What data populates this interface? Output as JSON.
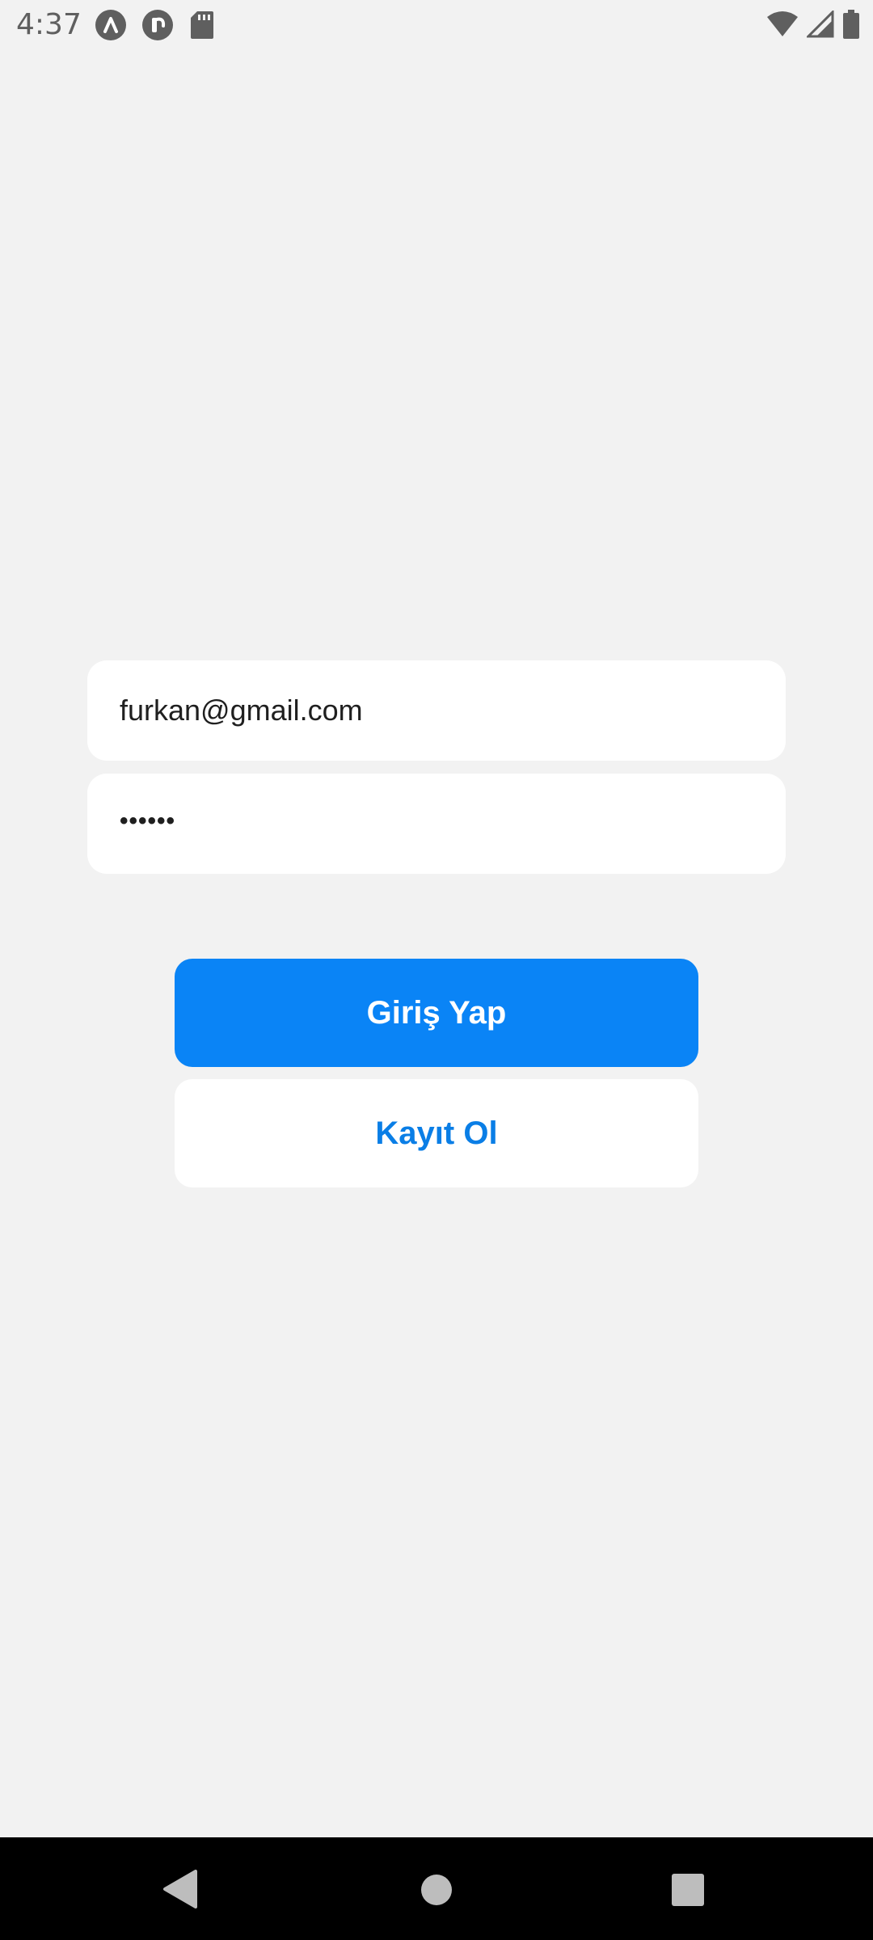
{
  "status_bar": {
    "time": "4:37",
    "icons_left": [
      "app-a-icon",
      "app-r-icon",
      "sd-card-icon"
    ],
    "icons_right": [
      "wifi-icon",
      "cellular-signal-icon",
      "battery-icon"
    ]
  },
  "login_form": {
    "email_value": "furkan@gmail.com",
    "password_masked": "••••••",
    "login_button_label": "Giriş Yap",
    "register_button_label": "Kayıt Ol"
  },
  "colors": {
    "background": "#f2f2f2",
    "primary": "#0a84f6",
    "register_text": "#0a7ee6"
  },
  "nav_bar": {
    "buttons": [
      "back-icon",
      "home-icon",
      "recents-icon"
    ]
  }
}
